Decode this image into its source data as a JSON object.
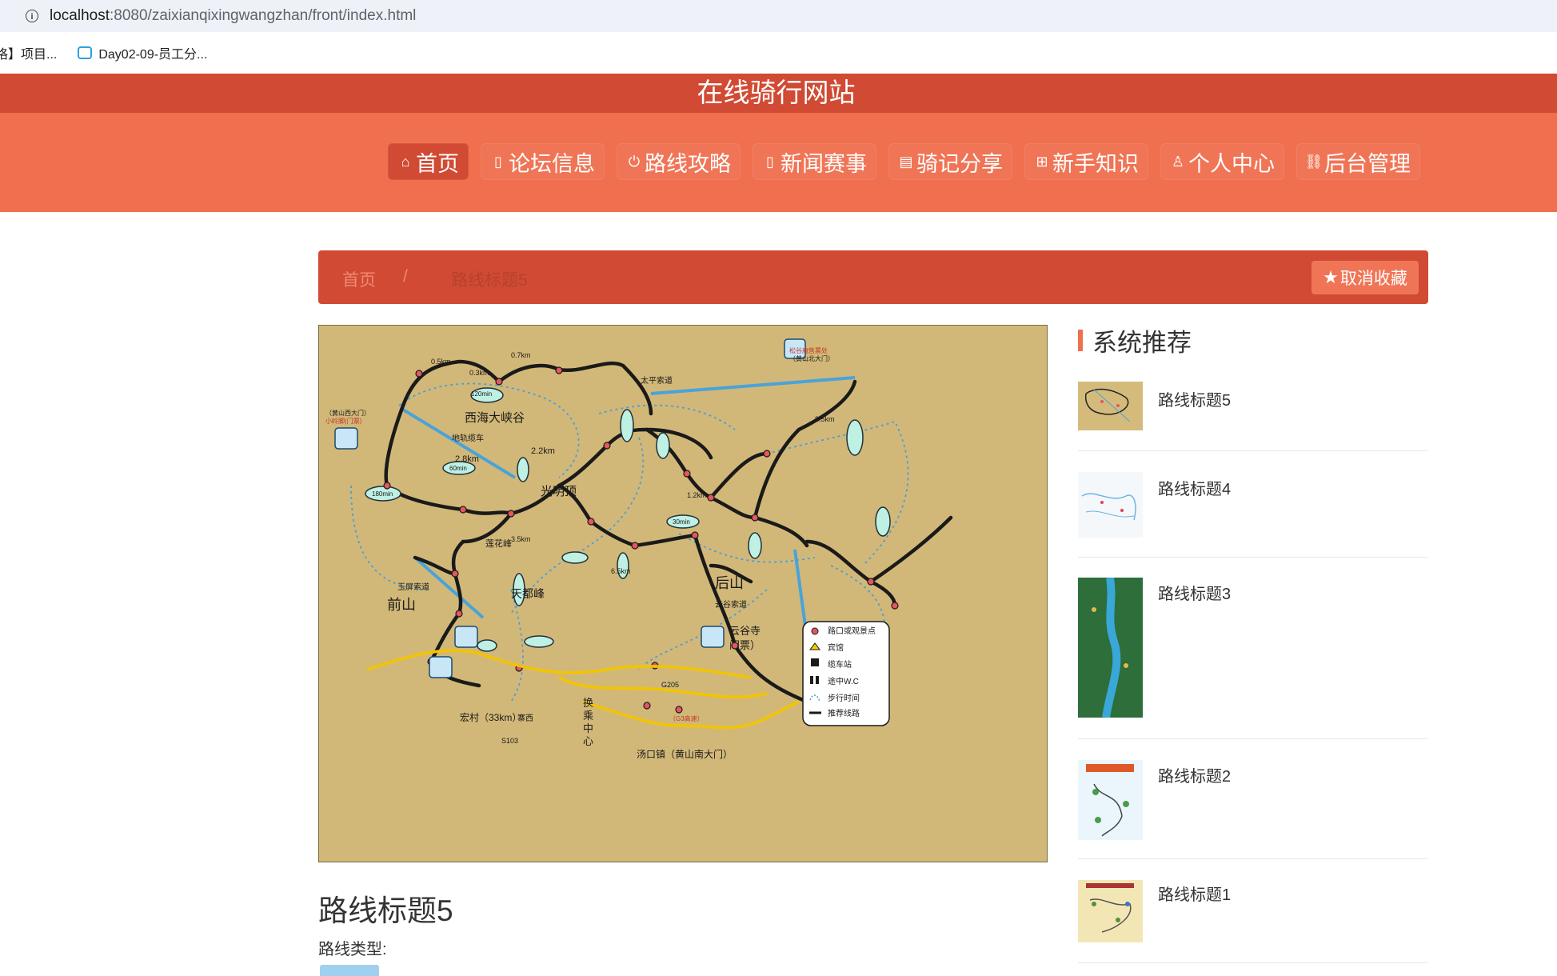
{
  "browser": {
    "url_host": "localhost",
    "url_rest": ":8080/zaixianqixingwangzhan/front/index.html",
    "bookmarks": [
      {
        "label": "咯】项目..."
      },
      {
        "label": "Day02-09-员工分..."
      }
    ]
  },
  "site": {
    "title": "在线骑行网站",
    "nav": [
      {
        "icon": "home-icon",
        "glyph": "⌂",
        "label": "首页",
        "active": true
      },
      {
        "icon": "book-icon",
        "glyph": "▯",
        "label": "论坛信息"
      },
      {
        "icon": "power-icon",
        "glyph": "⏻",
        "label": "路线攻略"
      },
      {
        "icon": "document-icon",
        "glyph": "▯",
        "label": "新闻赛事"
      },
      {
        "icon": "calendar-icon",
        "glyph": "▤",
        "label": "骑记分享"
      },
      {
        "icon": "open-book-icon",
        "glyph": "⊞",
        "label": "新手知识"
      },
      {
        "icon": "user-icon",
        "glyph": "♙",
        "label": "个人中心"
      },
      {
        "icon": "link-icon",
        "glyph": "⛓",
        "label": "后台管理"
      }
    ]
  },
  "breadcrumb": {
    "home": "首页",
    "separator": "/",
    "current": "路线标题5",
    "favorite_button": "取消收藏"
  },
  "detail": {
    "title": "路线标题5",
    "type_label": "路线类型:"
  },
  "map": {
    "big_labels": {
      "xihai": "西海大峡谷",
      "guangming": "光明顶",
      "houshan": "后山",
      "qianshan": "前山",
      "tiandu": "天都峰",
      "lianhua": "莲花峰",
      "huancheng": "换乘中心",
      "tangkou": "汤口镇（黄山南大门）",
      "hongcun": "宏村（33km）",
      "zhaixi": "寨西",
      "yungu": "云谷寺",
      "menpiao": "门票）",
      "taiping": "太平索道",
      "yunguSuodao": "云谷索道",
      "yupingSuodao": "玉屏索道",
      "ditie": "地轨缆车",
      "songgu": "松谷庵售票处",
      "songgu2": "（黄山北大门）",
      "xiaolingjiao": "小岭脚(门票)",
      "huangshanxi": "（黄山西大门）",
      "g205": "G205",
      "s103": "S103",
      "g3": "（G3高速）"
    },
    "legend": [
      {
        "icon": "dot-icon",
        "label": "路口或观景点"
      },
      {
        "icon": "hotel-icon",
        "label": "宾馆"
      },
      {
        "icon": "cable-car-icon",
        "label": "缆车站"
      },
      {
        "icon": "toilet-icon",
        "label": "途中W.C"
      },
      {
        "icon": "dotted-line-icon",
        "label": "步行时间"
      },
      {
        "icon": "solid-line-icon",
        "label": "推荐线路"
      }
    ],
    "time_badges": [
      "120min",
      "60min",
      "180min",
      "30min"
    ],
    "distances": [
      "0.5km",
      "0.3km",
      "0.7km",
      "2.2km",
      "2.8km",
      "1.2km",
      "8.5km",
      "3.5km",
      "6.5km"
    ]
  },
  "sidebar": {
    "heading": "系统推荐",
    "items": [
      {
        "label": "路线标题5",
        "thumb": "map-thumb-icon"
      },
      {
        "label": "路线标题4",
        "thumb": "map-thumb-icon"
      },
      {
        "label": "路线标题3",
        "thumb": "map-thumb-icon"
      },
      {
        "label": "路线标题2",
        "thumb": "map-thumb-icon"
      },
      {
        "label": "路线标题1",
        "thumb": "map-thumb-icon"
      }
    ]
  },
  "colors": {
    "header_dark": "#d14a33",
    "header_light": "#ef6f4f",
    "map_bg": "#d2b878"
  }
}
